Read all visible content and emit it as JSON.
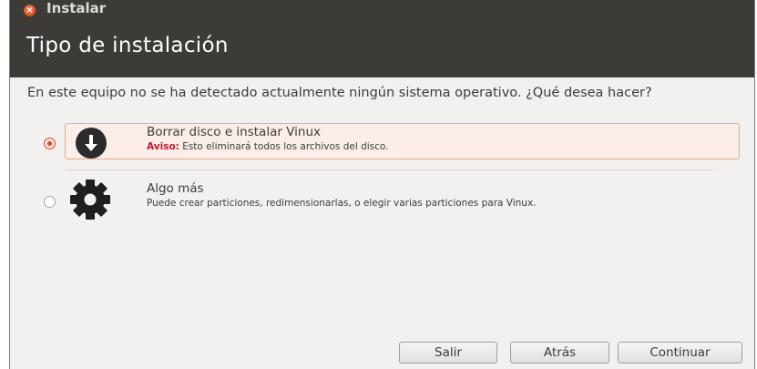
{
  "window": {
    "title": "Instalar",
    "close_glyph": "×"
  },
  "header": {
    "title": "Tipo de instalación"
  },
  "main": {
    "question": "En este equipo no se ha detectado actualmente ningún sistema operativo. ¿Qué desea hacer?",
    "options": [
      {
        "title": "Borrar disco e instalar Vinux",
        "warning_label": "Aviso:",
        "description": "Esto eliminará todos los archivos del disco.",
        "selected": true,
        "icon": "download-arrow-icon"
      },
      {
        "title": "Algo más",
        "description": "Puede crear particiones, redimensionarlas, o elegir varias particiones para Vinux.",
        "selected": false,
        "icon": "gear-icon"
      }
    ]
  },
  "buttons": {
    "quit": "Salir",
    "back": "Atrás",
    "continue": "Continuar"
  },
  "colors": {
    "header_bg": "#3c3b37",
    "accent": "#dd4814",
    "selection_bg": "#fbeee8",
    "warning": "#c7162b"
  }
}
